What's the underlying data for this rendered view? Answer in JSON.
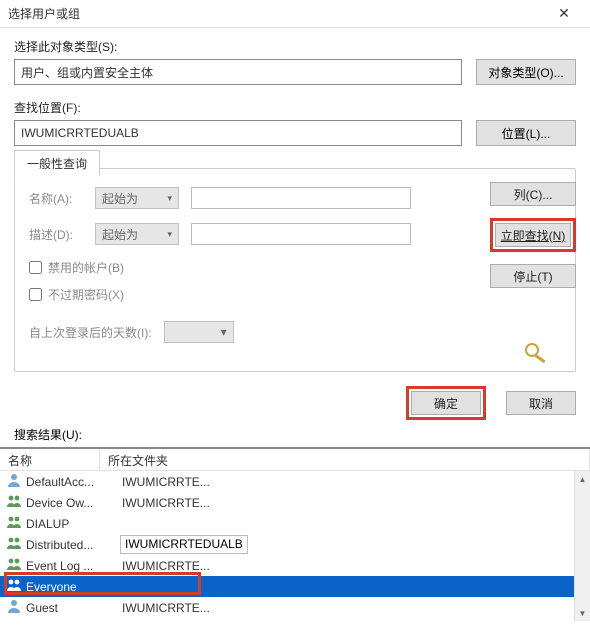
{
  "window": {
    "title": "选择用户或组"
  },
  "objectType": {
    "label": "选择此对象类型(S):",
    "value": "用户、组或内置安全主体",
    "button": "对象类型(O)..."
  },
  "location": {
    "label": "查找位置(F):",
    "value": "IWUMICRRTEDUALB",
    "button": "位置(L)..."
  },
  "tab": {
    "label": "一般性查询"
  },
  "query": {
    "nameLabel": "名称(A):",
    "nameMode": "起始为",
    "nameValue": "",
    "descLabel": "描述(D):",
    "descMode": "起始为",
    "descValue": "",
    "disabledAccounts": "禁用的帐户(B)",
    "neverExpire": "不过期密码(X)",
    "daysLabel": "自上次登录后的天数(I):"
  },
  "sideButtons": {
    "columns": "列(C)...",
    "findNow": "立即查找(N)",
    "stop": "停止(T)"
  },
  "bottomButtons": {
    "ok": "确定",
    "cancel": "取消"
  },
  "results": {
    "label": "搜索结果(U):",
    "colName": "名称",
    "colFolder": "所在文件夹",
    "rows": [
      {
        "name": "DefaultAcc...",
        "folder": "IWUMICRRTE...",
        "type": "user"
      },
      {
        "name": "Device Ow...",
        "folder": "IWUMICRRTE...",
        "type": "group"
      },
      {
        "name": "DIALUP",
        "folder": "",
        "type": "group"
      },
      {
        "name": "Distributed...",
        "folder": "IWUMICRRTEDUALB",
        "type": "group",
        "boxed": true
      },
      {
        "name": "Event Log ...",
        "folder": "IWUMICRRTE...",
        "type": "group"
      },
      {
        "name": "Everyone",
        "folder": "",
        "type": "group",
        "selected": true
      },
      {
        "name": "Guest",
        "folder": "IWUMICRRTE...",
        "type": "user"
      }
    ]
  }
}
